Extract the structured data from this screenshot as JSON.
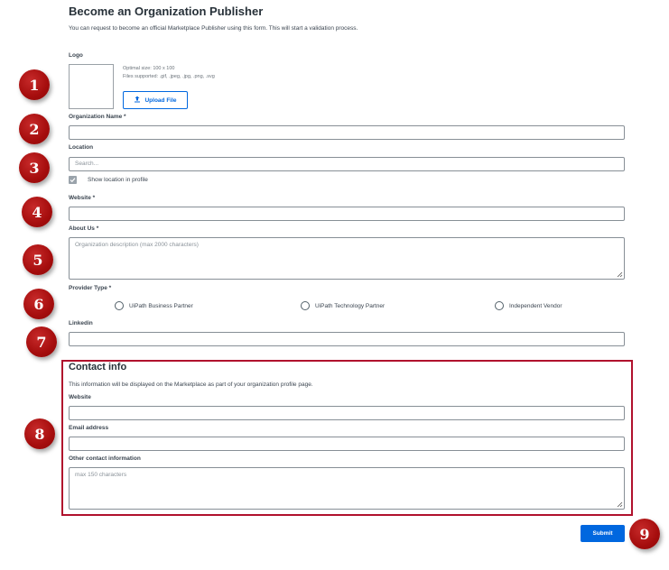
{
  "page": {
    "title": "Become an Organization Publisher",
    "subtitle": "You can request to become an official Marketplace Publisher using this form. This will start a validation process."
  },
  "logo": {
    "label": "Logo",
    "hint_size": "Optimal size: 100 x 100",
    "hint_types": "Files supported: .gif, .jpeg, .jpg, .png, .svg",
    "upload_label": "Upload File"
  },
  "fields": {
    "org_name_label": "Organization Name *",
    "location_label": "Location",
    "location_placeholder": "Search...",
    "show_location_label": "Show location in profile",
    "show_location_checked": true,
    "website_label": "Website *",
    "about_label": "About Us *",
    "about_placeholder": "Organization description (max 2000 characters)",
    "provider_label": "Provider Type *",
    "provider_options": [
      "UiPath Business Partner",
      "UiPath Technology Partner",
      "Independent Vendor"
    ],
    "linkedin_label": "Linkedin"
  },
  "contact": {
    "title": "Contact info",
    "description": "This information will be displayed on the Marketplace as part of your organization profile page.",
    "website_label": "Website",
    "email_label": "Email address",
    "other_label": "Other contact information",
    "other_placeholder": "max 150 characters"
  },
  "submit_label": "Submit",
  "badges": [
    "1",
    "2",
    "3",
    "4",
    "5",
    "6",
    "7",
    "8",
    "9"
  ],
  "colors": {
    "accent": "#0067df",
    "badge": "#a50d0d",
    "highlight_border": "#b0112d"
  }
}
